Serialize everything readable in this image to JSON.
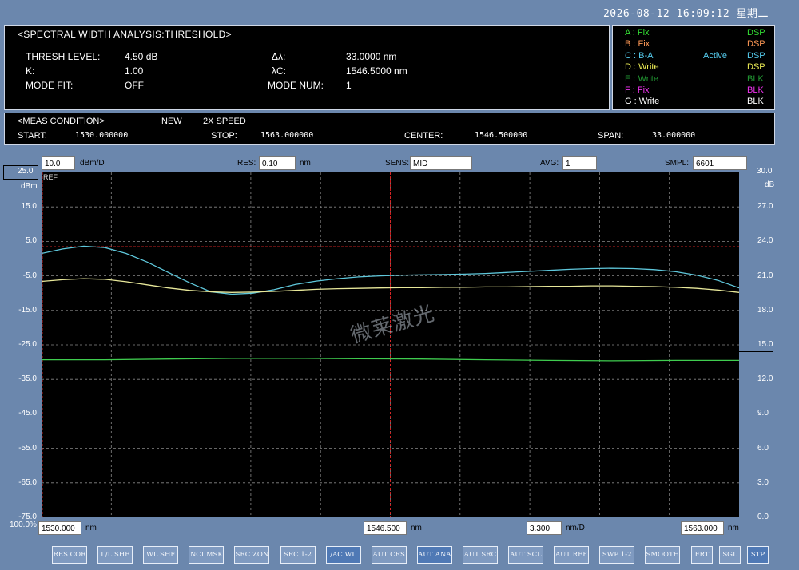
{
  "datetime": "2026-08-12 16:09:12 星期二",
  "analysis": {
    "title": "<SPECTRAL WIDTH ANALYSIS:THRESHOLD>",
    "thresh_label": "THRESH LEVEL:",
    "thresh_value": "4.50 dB",
    "k_label": "K:",
    "k_value": "1.00",
    "mode_fit_label": "MODE FIT:",
    "mode_fit_value": "OFF",
    "dl_label": "Δλ:",
    "dl_value": "33.0000 nm",
    "lc_label": "λC:",
    "lc_value": "1546.5000 nm",
    "mode_num_label": "MODE NUM:",
    "mode_num_value": "1"
  },
  "traces": [
    {
      "name": "A",
      "mode": "Fix",
      "state": "DSP",
      "color": "#33dd33",
      "state_color": "#33dd33"
    },
    {
      "name": "B",
      "mode": "Fix",
      "state": "DSP",
      "color": "#ff9955",
      "state_color": "#ff9955"
    },
    {
      "name": "C",
      "mode": "B-A",
      "active": "Active",
      "state": "DSP",
      "color": "#55ccee",
      "state_color": "#55ccee"
    },
    {
      "name": "D",
      "mode": "Write",
      "state": "DSP",
      "color": "#eeee55",
      "state_color": "#eeee55"
    },
    {
      "name": "E",
      "mode": "Write",
      "state": "BLK",
      "color": "#229933",
      "state_color": "#229933"
    },
    {
      "name": "F",
      "mode": "Fix",
      "state": "BLK",
      "color": "#ee33ee",
      "state_color": "#ee33ee"
    },
    {
      "name": "G",
      "mode": "Write",
      "state": "BLK",
      "color": "#ffffff",
      "state_color": "#ffffff"
    }
  ],
  "meas": {
    "title": "<MEAS CONDITION>",
    "new": "NEW",
    "speed": "2X SPEED",
    "start_label": "START:",
    "start_value": "1530.000000",
    "stop_label": "STOP:",
    "stop_value": "1563.000000",
    "center_label": "CENTER:",
    "center_value": "1546.500000",
    "span_label": "SPAN:",
    "span_value": "33.000000"
  },
  "settings": {
    "scale_value": "10.0",
    "scale_unit": "dBm/D",
    "res_label": "RES:",
    "res_value": "0.10",
    "res_unit": "nm",
    "sens_label": "SENS:",
    "sens_value": "MID",
    "avg_label": "AVG:",
    "avg_value": "1",
    "smpl_label": "SMPL:",
    "smpl_value": "6601"
  },
  "axis": {
    "left_top": "25.0",
    "left_unit": "dBm",
    "ref": "REF",
    "left_ticks": [
      "15.0",
      "5.0",
      "-5.0",
      "-15.0",
      "-25.0",
      "-35.0",
      "-45.0",
      "-55.0",
      "-65.0",
      "-75.0"
    ],
    "right_top": "30.0",
    "right_unit": "dB",
    "right_ticks": [
      "27.0",
      "24.0",
      "21.0",
      "18.0",
      "15.0",
      "12.0",
      "9.0",
      "6.0",
      "3.0",
      "0.0"
    ],
    "bottom_left_pct": "100.0%",
    "start_box": "1530.000",
    "start_unit": "nm",
    "center_box": "1546.500",
    "center_unit": "nm",
    "span_box": "3.300",
    "span_unit": "nm/D",
    "stop_box": "1563.000",
    "stop_unit": "nm"
  },
  "watermark": "微莱激光",
  "buttons": [
    {
      "label": "RES COR",
      "active": false
    },
    {
      "label": "L/L SHF",
      "active": false
    },
    {
      "label": "WL SHF",
      "active": false
    },
    {
      "label": "NCI MSK",
      "active": false
    },
    {
      "label": "SRC ZON",
      "active": false
    },
    {
      "label": "SRC 1-2",
      "active": false
    },
    {
      "label": "/AC WL",
      "active": true
    },
    {
      "label": "AUT CRS",
      "active": false
    },
    {
      "label": "AUT ANA",
      "active": true
    },
    {
      "label": "AUT SRC",
      "active": false
    },
    {
      "label": "AUT SCL",
      "active": false
    },
    {
      "label": "AUT REF",
      "active": false
    },
    {
      "label": "SWP 1-2",
      "active": false
    },
    {
      "label": "SMOOTH",
      "active": false
    },
    {
      "label": "FRT",
      "active": false
    },
    {
      "label": "SGL",
      "active": false
    },
    {
      "label": "STP",
      "active": true
    }
  ],
  "chart_data": {
    "type": "line",
    "xlim": [
      1530.0,
      1563.0
    ],
    "ylim": [
      -75.0,
      25.0
    ],
    "y2lim": [
      0.0,
      30.0
    ],
    "xlabel": "nm",
    "ylabel": "dBm",
    "y2label": "dB",
    "grid": true,
    "markers": {
      "threshold_dbm": -10.5,
      "ref_dbm": 3.5,
      "lambda_start": 1530.0,
      "lambda_center": 1546.5
    },
    "series": [
      {
        "color": "#5fc8dc",
        "x": [
          1530,
          1531,
          1532,
          1533,
          1534,
          1535,
          1536,
          1537,
          1538,
          1539,
          1540,
          1541,
          1542,
          1543,
          1544,
          1545,
          1546,
          1547,
          1548,
          1549,
          1550,
          1551,
          1552,
          1553,
          1554,
          1555,
          1556,
          1557,
          1558,
          1559,
          1560,
          1561,
          1562,
          1563
        ],
        "y": [
          1.5,
          2.8,
          3.6,
          3.2,
          1.5,
          -1,
          -4,
          -7,
          -9.6,
          -10.3,
          -10,
          -9,
          -7.5,
          -6.5,
          -5.8,
          -5.3,
          -5,
          -4.8,
          -4.7,
          -4.6,
          -4.5,
          -4.3,
          -4,
          -3.7,
          -3.4,
          -3.1,
          -2.9,
          -2.8,
          -2.9,
          -3.2,
          -3.8,
          -4.8,
          -6.3,
          -8.5
        ]
      },
      {
        "color": "#e8e89a",
        "x": [
          1530,
          1531,
          1532,
          1533,
          1534,
          1535,
          1536,
          1537,
          1538,
          1539,
          1540,
          1541,
          1542,
          1543,
          1544,
          1545,
          1546,
          1547,
          1548,
          1549,
          1550,
          1551,
          1552,
          1553,
          1554,
          1555,
          1556,
          1557,
          1558,
          1559,
          1560,
          1561,
          1562,
          1563
        ],
        "y": [
          -6.6,
          -6.1,
          -5.8,
          -6.0,
          -6.7,
          -7.6,
          -8.5,
          -9.2,
          -9.6,
          -9.8,
          -9.7,
          -9.5,
          -9.2,
          -8.9,
          -8.7,
          -8.6,
          -8.5,
          -8.4,
          -8.4,
          -8.3,
          -8.3,
          -8.2,
          -8.2,
          -8.1,
          -8.0,
          -8.0,
          -7.9,
          -7.9,
          -8.0,
          -8.1,
          -8.3,
          -8.6,
          -9.1,
          -9.8
        ]
      },
      {
        "color": "#3fcc4f",
        "x": [
          1530,
          1533,
          1536,
          1539,
          1542,
          1545,
          1548,
          1551,
          1554,
          1557,
          1560,
          1563
        ],
        "y": [
          -29.3,
          -29.3,
          -29.1,
          -28.9,
          -28.9,
          -29.0,
          -29.1,
          -29.3,
          -29.5,
          -29.6,
          -29.5,
          -29.5
        ]
      }
    ]
  }
}
